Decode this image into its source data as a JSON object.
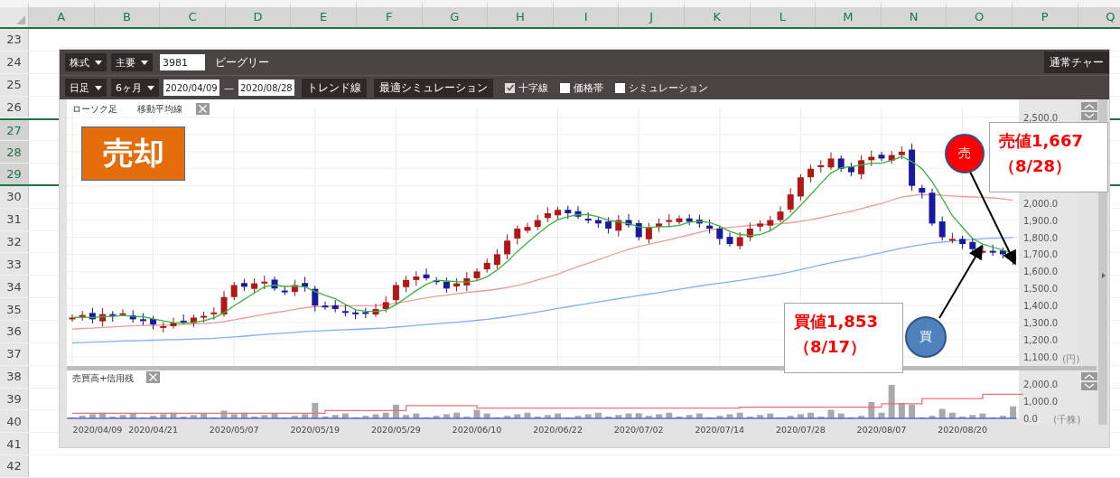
{
  "sheet": {
    "columns": [
      "A",
      "B",
      "C",
      "D",
      "E",
      "F",
      "G",
      "H",
      "I",
      "J",
      "K",
      "L",
      "M",
      "N",
      "O",
      "P",
      "Q"
    ],
    "rows": [
      {
        "label": "23",
        "selected": false
      },
      {
        "label": "24",
        "selected": false
      },
      {
        "label": "25",
        "selected": false
      },
      {
        "label": "26",
        "selected": false
      },
      {
        "label": "27",
        "selected": true
      },
      {
        "label": "28",
        "selected": true
      },
      {
        "label": "29",
        "selected": true
      },
      {
        "label": "30",
        "selected": false
      },
      {
        "label": "31",
        "selected": false
      },
      {
        "label": "32",
        "selected": false
      },
      {
        "label": "33",
        "selected": false
      },
      {
        "label": "34",
        "selected": false
      },
      {
        "label": "35",
        "selected": false
      },
      {
        "label": "36",
        "selected": false
      },
      {
        "label": "37",
        "selected": false
      },
      {
        "label": "38",
        "selected": false
      },
      {
        "label": "39",
        "selected": false
      },
      {
        "label": "40",
        "selected": false
      },
      {
        "label": "41",
        "selected": false
      },
      {
        "label": "42",
        "selected": false
      }
    ]
  },
  "app": {
    "toolbar_1": {
      "market_dropdown": "株式",
      "info_dropdown": "主要",
      "code_field": "3981",
      "company_name": "ビーグリー",
      "chart_mode_button": "通常チャー"
    },
    "toolbar_2": {
      "period_dropdown": "日足",
      "range_dropdown": "6ヶ月",
      "start_date": "2020/04/09",
      "date_separator": "—",
      "end_date": "2020/08/28",
      "buttons": [
        "トレンド線",
        "最適シミュレーション"
      ],
      "options": [
        {
          "label": "十字線",
          "checked": true
        },
        {
          "label": "価格帯",
          "checked": false
        },
        {
          "label": "シミュレーション",
          "checked": false
        }
      ]
    },
    "price_chart": {
      "legend": [
        "ローソク足",
        "移動平均線"
      ],
      "y_axis_labels": [
        "2,500.0",
        "2,000.0",
        "1,900.0",
        "1,800.0",
        "1,700.0",
        "1,600.0",
        "1,500.0",
        "1,400.0",
        "1,300.0",
        "1,200.0",
        "1,100.0"
      ],
      "unit": "(円)"
    },
    "volume_chart": {
      "legend": "売買高+信用残",
      "y_axis_labels": [
        "2,000.0",
        "1,000.0",
        "0.0"
      ],
      "unit": "(千株)"
    },
    "x_axis_labels": [
      "2020/04/09",
      "2020/04/21",
      "2020/05/07",
      "2020/05/19",
      "2020/05/29",
      "2020/06/10",
      "2020/06/22",
      "2020/07/02",
      "2020/07/14",
      "2020/07/28",
      "2020/08/07",
      "2020/08/20"
    ]
  },
  "annotations": {
    "title_label": "売却",
    "sell_marker": "売",
    "sell_callout": [
      "売値1,667",
      "（8/28）"
    ],
    "buy_marker": "買",
    "buy_callout": [
      "買値1,853",
      "（8/17）"
    ]
  }
}
